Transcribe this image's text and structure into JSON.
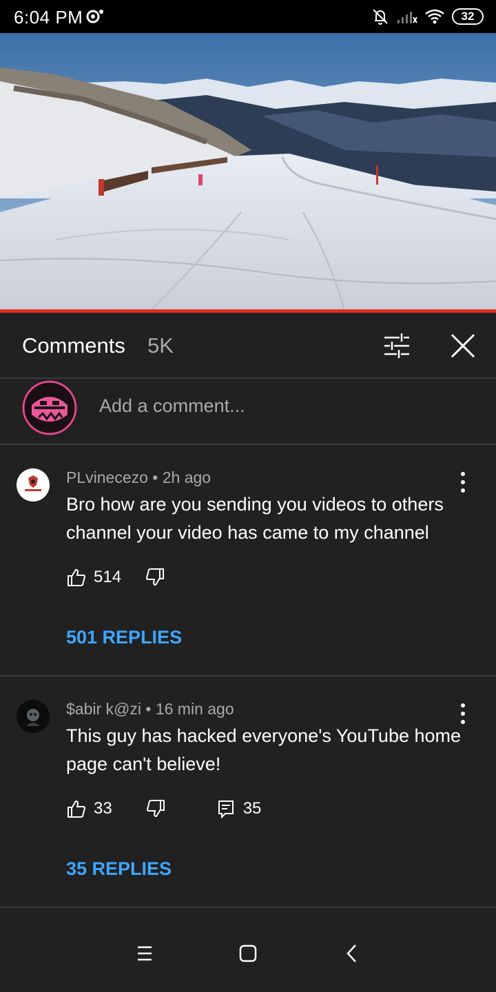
{
  "status_bar": {
    "time": "6:04 PM",
    "battery": "32",
    "icons": [
      "message-icon",
      "bell-muted-icon",
      "signal-icon",
      "wifi-icon",
      "battery-icon"
    ]
  },
  "video": {
    "progress_fraction": 1.0,
    "progress_color": "#e52d27"
  },
  "comments_panel": {
    "title": "Comments",
    "count": "5K",
    "add_comment_placeholder": "Add a comment..."
  },
  "comments": [
    {
      "author": "PLvinecezo",
      "time": "2h ago",
      "meta": "PLvinecezo • 2h ago",
      "text": "Bro how are you sending you videos to others channel your video has came to my channel",
      "likes": "514",
      "reply_count": "",
      "replies_label": "501 REPLIES"
    },
    {
      "author": "$abir k@zi",
      "time": "16 min ago",
      "meta": "$abir k@zi • 16 min ago",
      "text": "This guy has hacked everyone's YouTube home page can't believe!",
      "likes": "33",
      "reply_count": "35",
      "replies_label": "35 REPLIES"
    }
  ],
  "colors": {
    "background": "#212121",
    "accent_link": "#3ea6ff",
    "divider": "#3a3a3a"
  }
}
